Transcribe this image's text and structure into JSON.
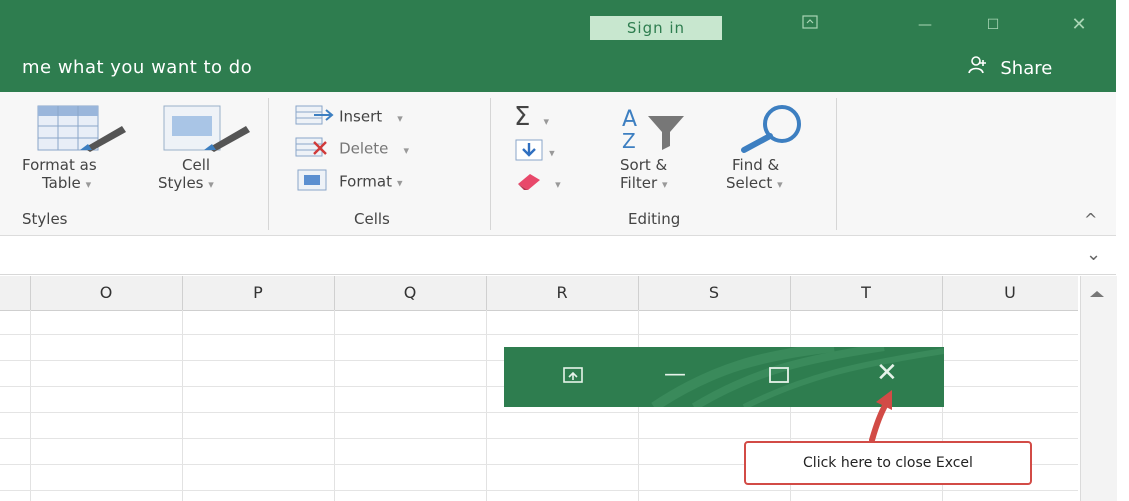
{
  "titlebar": {
    "sign_in": "Sign in",
    "restore_icon": "ribbon-display-icon",
    "minimize_glyph": "—",
    "maximize_glyph": "☐",
    "close_glyph": "✕"
  },
  "tellme": {
    "text": "me what you want to do",
    "share_label": "Share"
  },
  "ribbon": {
    "styles_group": {
      "format_as_table_line1": "Format as",
      "format_as_table_line2": "Table",
      "cell_styles_line1": "Cell",
      "cell_styles_line2": "Styles",
      "label": "Styles"
    },
    "cells_group": {
      "insert": "Insert",
      "delete": "Delete",
      "format": "Format",
      "label": "Cells"
    },
    "editing_group": {
      "sort_filter_line1": "Sort &",
      "sort_filter_line2": "Filter",
      "find_select_line1": "Find &",
      "find_select_line2": "Select",
      "label": "Editing"
    },
    "dropdown_glyph": "▾",
    "collapse_glyph": "^"
  },
  "formula": {
    "expand_glyph": "⌄"
  },
  "sheet": {
    "columns": [
      "O",
      "P",
      "Q",
      "R",
      "S",
      "T",
      "U"
    ]
  },
  "zoom": {
    "close_glyph": "✕",
    "minimize_glyph": "—"
  },
  "callout": {
    "text": "Click here to close Excel"
  },
  "colors": {
    "excel_green": "#2e7d4f",
    "callout_red": "#d24b46",
    "sign_in_bg": "#c8e7cf"
  }
}
